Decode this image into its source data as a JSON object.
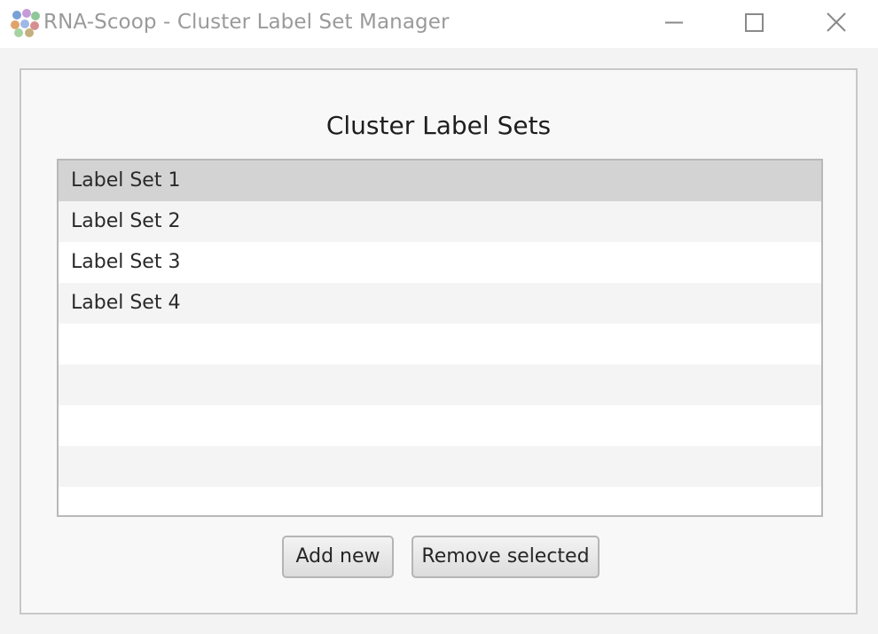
{
  "window": {
    "title": "RNA-Scoop - Cluster Label Set Manager",
    "controls": [
      "minimize-icon",
      "maximize-icon",
      "close-icon"
    ]
  },
  "panel": {
    "title": "Cluster Label Sets"
  },
  "label_sets": {
    "items": [
      "Label Set 1",
      "Label Set 2",
      "Label Set 3",
      "Label Set 4"
    ],
    "selected_index": 0
  },
  "buttons": {
    "add_label": "Add new",
    "remove_label": "Remove selected"
  },
  "colors": {
    "selected_row": "#d3d3d3",
    "alt_row": "#f4f4f4",
    "title_text": "#9a9a9a"
  }
}
